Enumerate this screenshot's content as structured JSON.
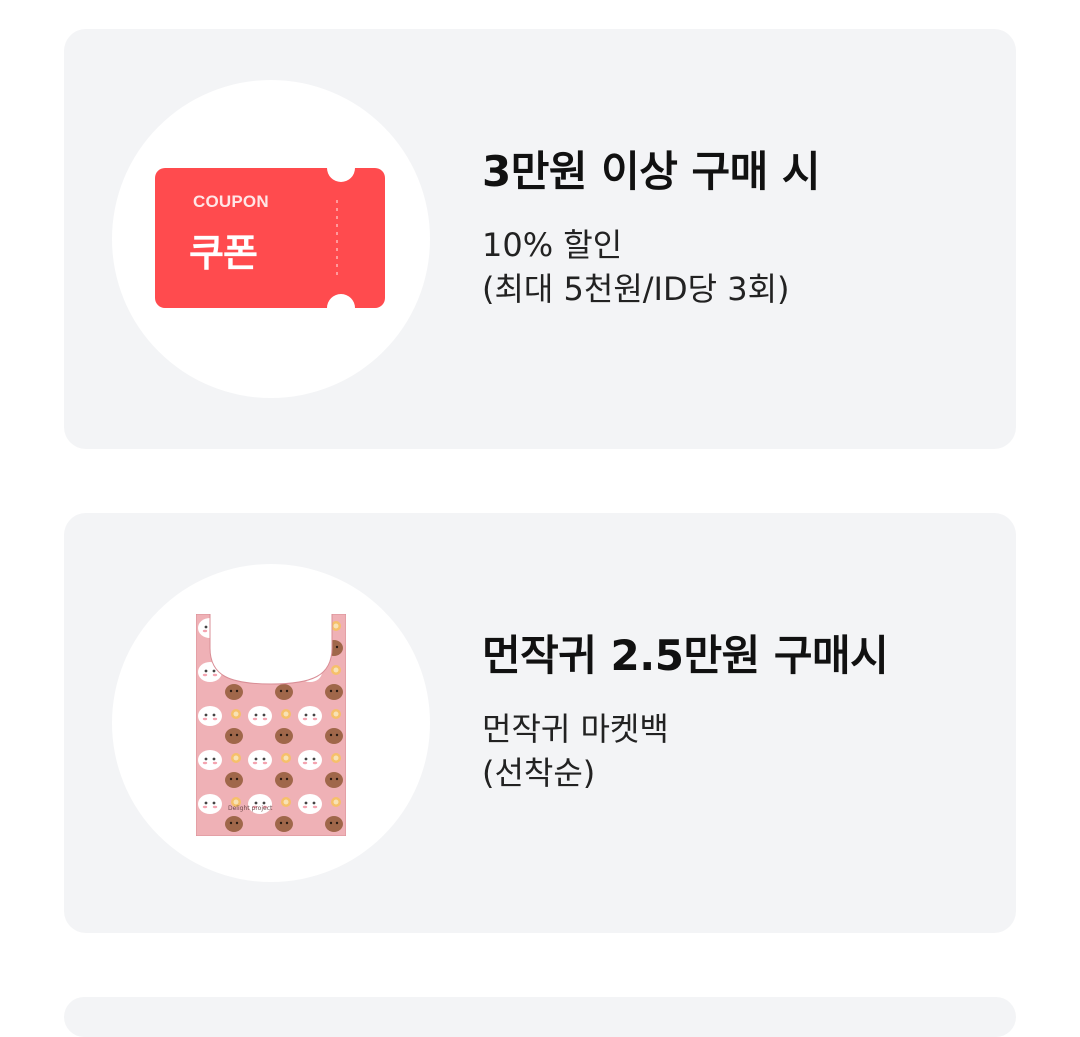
{
  "cards": [
    {
      "title": "3만원 이상 구매 시",
      "desc_line1": "10% 할인",
      "desc_line2": "(최대 5천원/ID당 3회)",
      "image": {
        "icon": "coupon-ticket-icon",
        "small_label": "COUPON",
        "big_label": "쿠폰",
        "color": "#ff4b4e"
      }
    },
    {
      "title": "먼작귀 2.5만원 구매시",
      "desc_line1": "먼작귀 마켓백",
      "desc_line2": "(선착순)",
      "image": {
        "icon": "market-bag-icon",
        "bag_text": "Delight project",
        "color": "#e8a2a8"
      }
    }
  ],
  "colors": {
    "card_bg": "#f3f4f6",
    "title_text": "#111111",
    "body_text": "#222222"
  }
}
